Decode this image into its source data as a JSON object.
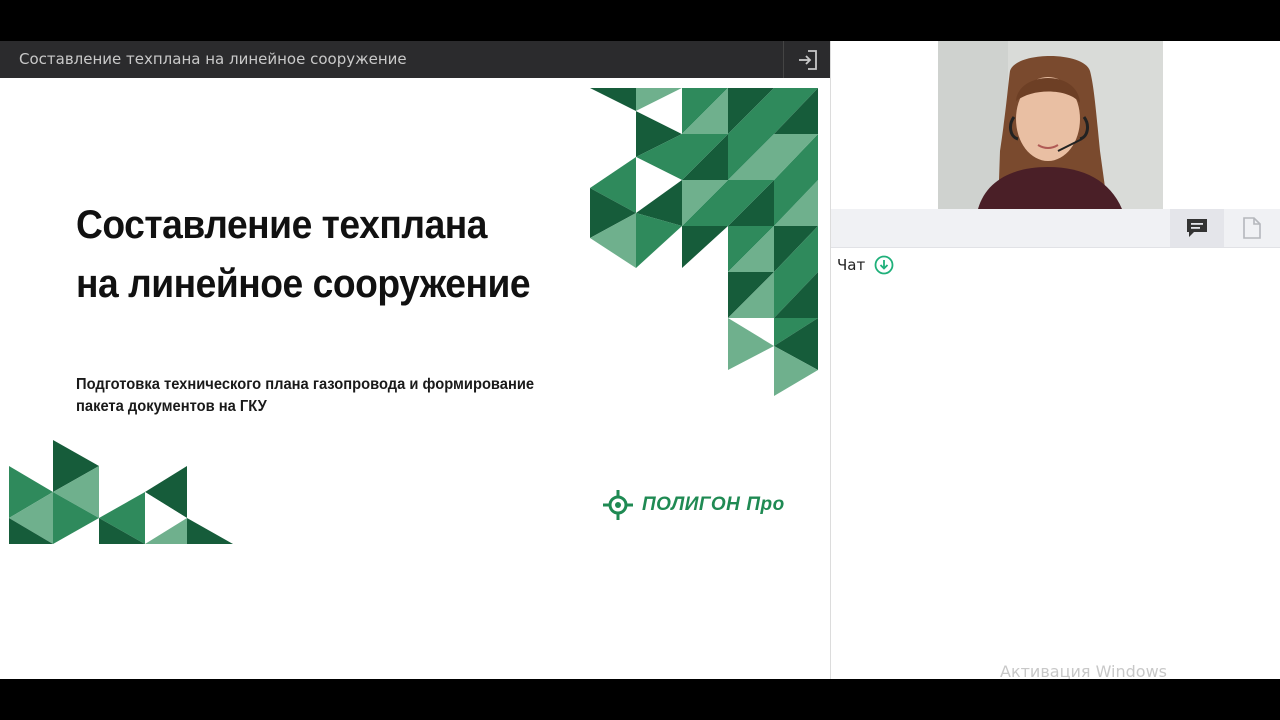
{
  "presentation": {
    "header_title": "Составление техплана на линейное сооружение",
    "exit_icon": "sign-out-icon"
  },
  "slide": {
    "title_lines": [
      "Составление техплана",
      "на линейное сооружение"
    ],
    "subtitle_lines": [
      "Подготовка технического плана газопровода и формирование",
      "пакета документов на ГКУ"
    ],
    "logo": {
      "name": "ПОЛИГОН",
      "suffix": "Про"
    },
    "colors": {
      "dark_green": "#165c3a",
      "mid_green": "#2f8a5c",
      "light_green": "#6fb08d",
      "logo_green": "#1f8a53"
    }
  },
  "side_panel": {
    "tabs": [
      {
        "icon": "chat-icon",
        "active": true
      },
      {
        "icon": "file-icon",
        "active": false
      }
    ],
    "chat": {
      "label": "Чат",
      "icon": "download-circle-icon"
    },
    "watermark": "Активация Windows"
  }
}
